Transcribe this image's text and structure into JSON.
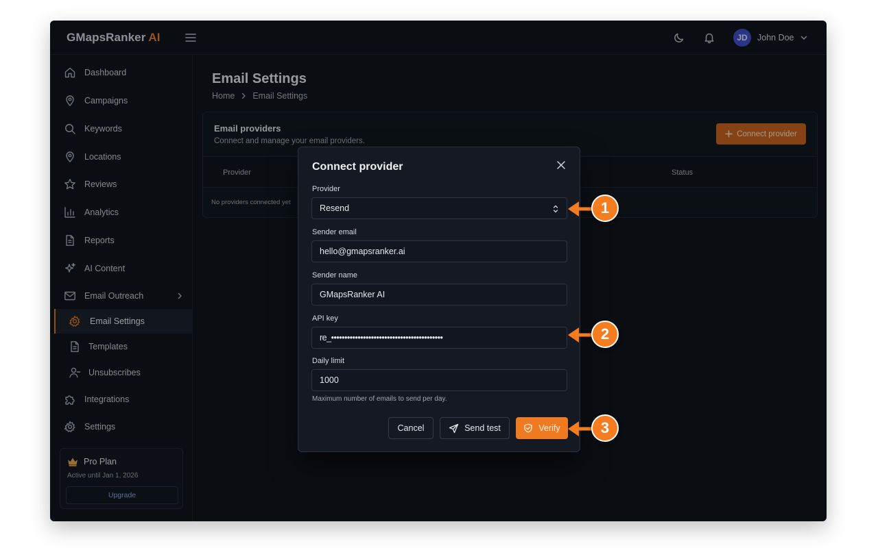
{
  "header": {
    "brand_name": "GMapsRanker",
    "brand_suffix": "AI",
    "user_initials": "JD",
    "user_name": "John Doe"
  },
  "sidebar": {
    "items": [
      {
        "label": "Dashboard",
        "icon": "home-icon"
      },
      {
        "label": "Campaigns",
        "icon": "map-pin-icon"
      },
      {
        "label": "Keywords",
        "icon": "search-icon"
      },
      {
        "label": "Locations",
        "icon": "map-pin-icon"
      },
      {
        "label": "Reviews",
        "icon": "star-icon"
      },
      {
        "label": "Analytics",
        "icon": "bar-chart-icon"
      },
      {
        "label": "Reports",
        "icon": "file-icon"
      },
      {
        "label": "AI Content",
        "icon": "sparkle-icon"
      },
      {
        "label": "Email Outreach",
        "icon": "mail-icon"
      },
      {
        "label": "Email Settings",
        "icon": "gear-icon"
      },
      {
        "label": "Templates",
        "icon": "file-icon"
      },
      {
        "label": "Unsubscribes",
        "icon": "user-minus-icon"
      },
      {
        "label": "Integrations",
        "icon": "puzzle-icon"
      },
      {
        "label": "Settings",
        "icon": "gear-icon"
      }
    ],
    "plan": {
      "title": "Pro Plan",
      "subtitle": "Active until Jan 1, 2026",
      "button": "Upgrade"
    }
  },
  "main": {
    "title": "Email Settings",
    "breadcrumb": [
      "Home",
      "Email Settings"
    ],
    "card": {
      "title": "Email providers",
      "subtitle": "Connect and manage your email providers.",
      "connect_button": "Connect provider",
      "columns": [
        "Provider",
        "Status"
      ],
      "empty_text": "No providers connected yet"
    }
  },
  "modal": {
    "title": "Connect provider",
    "provider_label": "Provider",
    "provider_value": "Resend",
    "sender_email_label": "Sender email",
    "sender_email_value": "hello@gmapsranker.ai",
    "sender_name_label": "Sender name",
    "sender_name_value": "GMapsRanker AI",
    "api_key_label": "API key",
    "api_key_value": "re_••••••••••••••••••••••••••••••••••••••••••",
    "daily_limit_label": "Daily limit",
    "daily_limit_value": "1000",
    "daily_limit_hint": "Maximum number of emails to send per day.",
    "cancel_button": "Cancel",
    "send_test_button": "Send test",
    "verify_button": "Verify"
  },
  "annotations": [
    "1",
    "2",
    "3"
  ],
  "colors": {
    "accent": "#f07a20",
    "background": "#0d1117",
    "avatar": "#3e4fc7"
  }
}
